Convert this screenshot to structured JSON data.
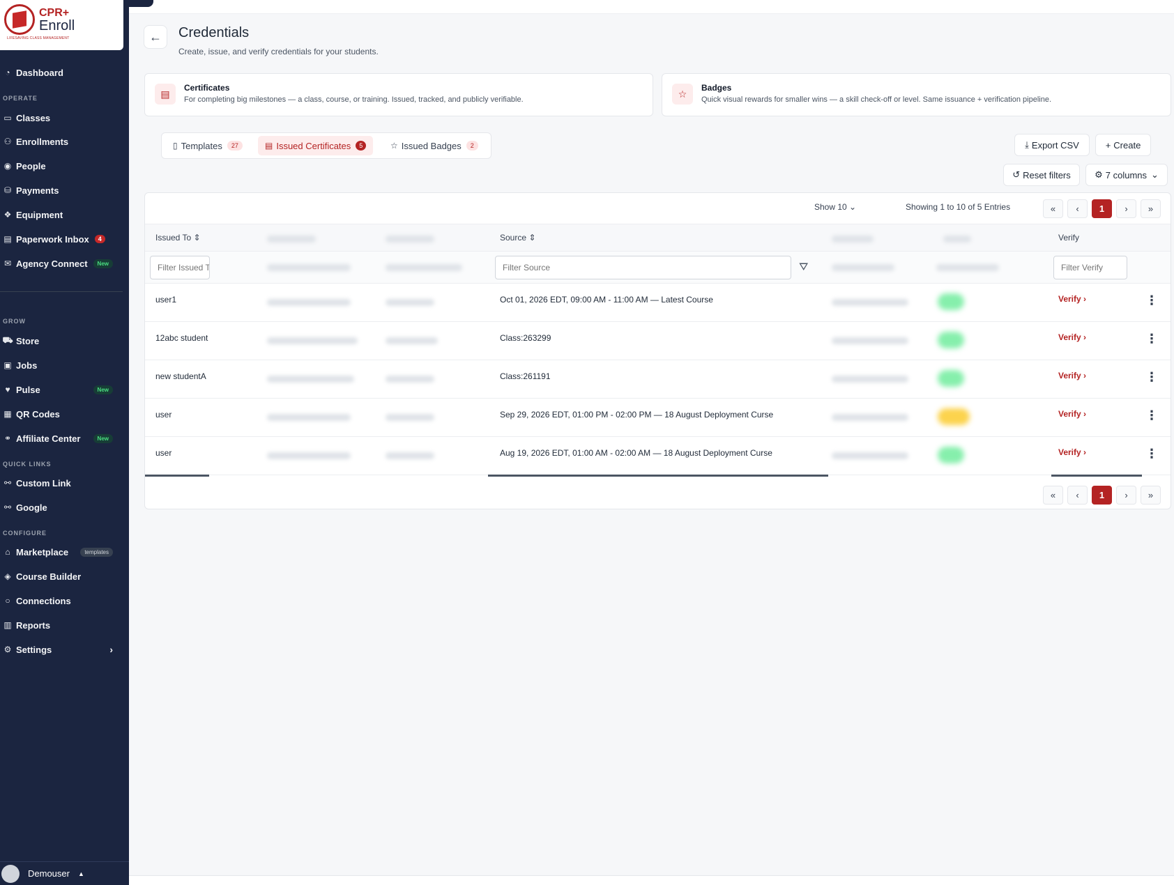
{
  "brand": {
    "name_top": "CPR+",
    "name_bottom": "Enroll",
    "tagline": "LIFESAVING CLASS MANAGEMENT"
  },
  "sidebar": {
    "dashboard": "Dashboard",
    "sections": {
      "operate": "OPERATE",
      "grow": "GROW",
      "quick_links": "QUICK LINKS",
      "configure": "CONFIGURE"
    },
    "operate": [
      {
        "label": "Classes"
      },
      {
        "label": "Enrollments"
      },
      {
        "label": "People"
      },
      {
        "label": "Payments"
      },
      {
        "label": "Equipment"
      },
      {
        "label": "Paperwork Inbox",
        "count": "4"
      },
      {
        "label": "Agency Connect",
        "badge": "New"
      }
    ],
    "grow": [
      {
        "label": "Store"
      },
      {
        "label": "Jobs"
      },
      {
        "label": "Pulse",
        "badge": "New"
      },
      {
        "label": "QR Codes"
      },
      {
        "label": "Affiliate Center",
        "badge": "New"
      }
    ],
    "quick_links": [
      {
        "label": "Custom Link"
      },
      {
        "label": "Google"
      }
    ],
    "configure": [
      {
        "label": "Marketplace",
        "badge": "templates"
      },
      {
        "label": "Course Builder"
      },
      {
        "label": "Connections"
      },
      {
        "label": "Reports"
      },
      {
        "label": "Settings"
      }
    ],
    "user": "Demouser"
  },
  "header": {
    "title": "Credentials",
    "subtitle": "Create, issue, and verify credentials for your students."
  },
  "cards": {
    "certificates": {
      "title": "Certificates",
      "desc": "For completing big milestones — a class, course, or training. Issued, tracked, and publicly verifiable."
    },
    "badges": {
      "title": "Badges",
      "desc": "Quick visual rewards for smaller wins — a skill check-off or level. Same issuance + verification pipeline."
    }
  },
  "tabs": [
    {
      "label": "Templates",
      "count": "27"
    },
    {
      "label": "Issued Certificates",
      "count": "5"
    },
    {
      "label": "Issued Badges",
      "count": "2"
    }
  ],
  "actions": {
    "export": "Export CSV",
    "create": "Create",
    "reset": "Reset filters",
    "columns": "7 columns"
  },
  "table": {
    "show_label": "Show  10",
    "showing": "Showing 1 to 10 of 5 Entries",
    "current_page": "1",
    "headers": {
      "issued_to": "Issued To",
      "source": "Source",
      "verify": "Verify"
    },
    "filters": {
      "issued_to": "Filter Issued To",
      "source": "Filter Source",
      "verify": "Filter Verify"
    },
    "verify_label": "Verify ›",
    "rows": [
      {
        "issued_to": "user1",
        "source": "Oct 01, 2026 EDT, 09:00 AM - 11:00 AM — Latest Course",
        "status_color": "#86efac"
      },
      {
        "issued_to": "12abc student",
        "source": "Class:263299",
        "status_color": "#86efac"
      },
      {
        "issued_to": "new studentA",
        "source": "Class:261191",
        "status_color": "#86efac"
      },
      {
        "issued_to": "user",
        "source": "Sep 29, 2026 EDT, 01:00 PM - 02:00 PM — 18 August Deployment Curse",
        "status_color": "#fcd34d"
      },
      {
        "issued_to": "user",
        "source": "Aug 19, 2026 EDT, 01:00 AM - 02:00 AM — 18 August Deployment Curse",
        "status_color": "#86efac"
      }
    ]
  },
  "colors": {
    "accent": "#b42323",
    "sidebar": "#1b2540"
  }
}
